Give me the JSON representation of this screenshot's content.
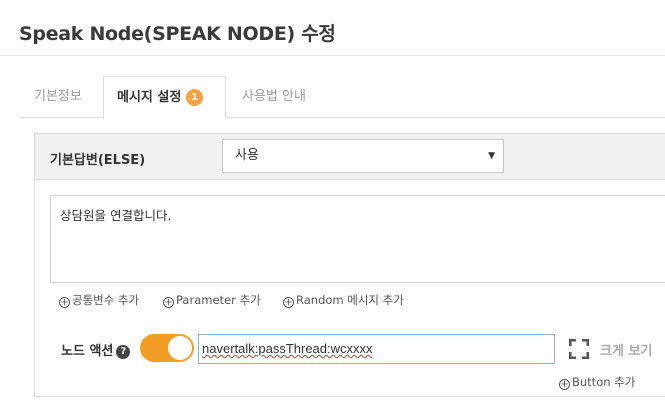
{
  "page": {
    "title": "Speak Node(SPEAK NODE) 수정"
  },
  "tabs": [
    {
      "label": "기본정보"
    },
    {
      "label": "메시지 설정",
      "badge": "1"
    },
    {
      "label": "사용법 안내"
    }
  ],
  "panel": {
    "head_label": "기본답변(ELSE)",
    "select_value": "사용",
    "message_text": "상담원을 연결합니다.",
    "add_links": {
      "common_var": "공통변수 추가",
      "parameter": "Parameter 추가",
      "random_message": "Random 메시지 추가"
    },
    "node_action_label": "노드 액션",
    "node_action_value": "navertalk:passThread:wcxxxx",
    "expand_label": "크게 보기",
    "button_add": "Button 추가"
  },
  "colors": {
    "accent": "#f39c26",
    "badge": "#f4a340",
    "input_focus": "#8fb0de"
  },
  "icons": [
    "help-icon",
    "expand-icon",
    "plus-circle-icon",
    "chevron-down-icon"
  ]
}
